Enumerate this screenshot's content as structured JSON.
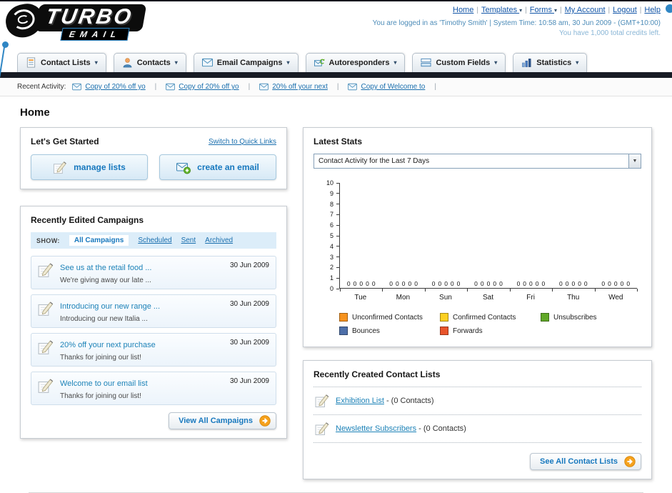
{
  "header": {
    "logo_title": "TURBO",
    "logo_subtitle": "EMAIL",
    "nav_links": [
      {
        "label": "Home",
        "dropdown": false
      },
      {
        "label": "Templates",
        "dropdown": true
      },
      {
        "label": "Forms",
        "dropdown": true
      },
      {
        "label": "My Account",
        "dropdown": false
      },
      {
        "label": "Logout",
        "dropdown": false
      },
      {
        "label": "Help",
        "dropdown": false
      }
    ],
    "login_info": "You are logged in as 'Timothy Smith' | System Time: 10:58 am, 30 Jun 2009 - (GMT+10:00)",
    "credits_info": "You have 1,000 total credits left."
  },
  "main_nav": {
    "tabs": [
      {
        "label": "Contact Lists",
        "icon": "contact-lists-icon"
      },
      {
        "label": "Contacts",
        "icon": "contacts-icon"
      },
      {
        "label": "Email Campaigns",
        "icon": "email-campaigns-icon"
      },
      {
        "label": "Autoresponders",
        "icon": "autoresponders-icon"
      },
      {
        "label": "Custom Fields",
        "icon": "custom-fields-icon"
      },
      {
        "label": "Statistics",
        "icon": "statistics-icon"
      }
    ]
  },
  "recent_activity": {
    "label": "Recent Activity:",
    "items": [
      "Copy of 20% off yo",
      "Copy of 20% off yo",
      "20% off your next",
      "Copy of Welcome to"
    ]
  },
  "page_title": "Home",
  "get_started": {
    "title": "Let's Get Started",
    "switch_link": "Switch to Quick Links",
    "buttons": [
      {
        "label": "manage lists",
        "icon": "pencil-icon"
      },
      {
        "label": "create an email",
        "icon": "envelope-plus-icon"
      }
    ]
  },
  "campaigns": {
    "title": "Recently Edited Campaigns",
    "show_label": "SHOW:",
    "filters": [
      "All Campaigns",
      "Scheduled",
      "Sent",
      "Archived"
    ],
    "active_filter": "All Campaigns",
    "items": [
      {
        "title": "See us at the retail food ...",
        "subtitle": "We're giving away our late ...",
        "date": "30 Jun 2009"
      },
      {
        "title": "Introducing our new range ...",
        "subtitle": "Introducing our new Italia ...",
        "date": "30 Jun 2009"
      },
      {
        "title": "20% off your next purchase",
        "subtitle": "Thanks for joining our list!",
        "date": "30 Jun 2009"
      },
      {
        "title": "Welcome to our email list",
        "subtitle": "Thanks for joining our list!",
        "date": "30 Jun 2009"
      }
    ],
    "view_all_label": "View All Campaigns"
  },
  "latest_stats": {
    "title": "Latest Stats",
    "dropdown_value": "Contact Activity for the Last 7 Days"
  },
  "chart_data": {
    "type": "bar",
    "title": "Contact Activity for the Last 7 Days",
    "categories": [
      "Tue",
      "Mon",
      "Sun",
      "Sat",
      "Fri",
      "Thu",
      "Wed"
    ],
    "series": [
      {
        "name": "Unconfirmed Contacts",
        "color": "#f6921e",
        "values": [
          0,
          0,
          0,
          0,
          0,
          0,
          0
        ]
      },
      {
        "name": "Confirmed Contacts",
        "color": "#fdd021",
        "values": [
          0,
          0,
          0,
          0,
          0,
          0,
          0
        ]
      },
      {
        "name": "Unsubscribes",
        "color": "#61a828",
        "values": [
          0,
          0,
          0,
          0,
          0,
          0,
          0
        ]
      },
      {
        "name": "Bounces",
        "color": "#4d6fa8",
        "values": [
          0,
          0,
          0,
          0,
          0,
          0,
          0
        ]
      },
      {
        "name": "Forwards",
        "color": "#e8542b",
        "values": [
          0,
          0,
          0,
          0,
          0,
          0,
          0
        ]
      }
    ],
    "xlabel": "",
    "ylabel": "",
    "ylim": [
      0,
      10
    ],
    "yticks": [
      0,
      1,
      2,
      3,
      4,
      5,
      6,
      7,
      8,
      9,
      10
    ],
    "grid": false,
    "legend_position": "bottom",
    "value_labels_shown": true
  },
  "contact_lists": {
    "title": "Recently Created Contact Lists",
    "items": [
      {
        "name": "Exhibition List",
        "suffix": "- (0 Contacts)"
      },
      {
        "name": "Newsletter Subscribers",
        "suffix": "- (0 Contacts)"
      }
    ],
    "see_all_label": "See All Contact Lists"
  }
}
